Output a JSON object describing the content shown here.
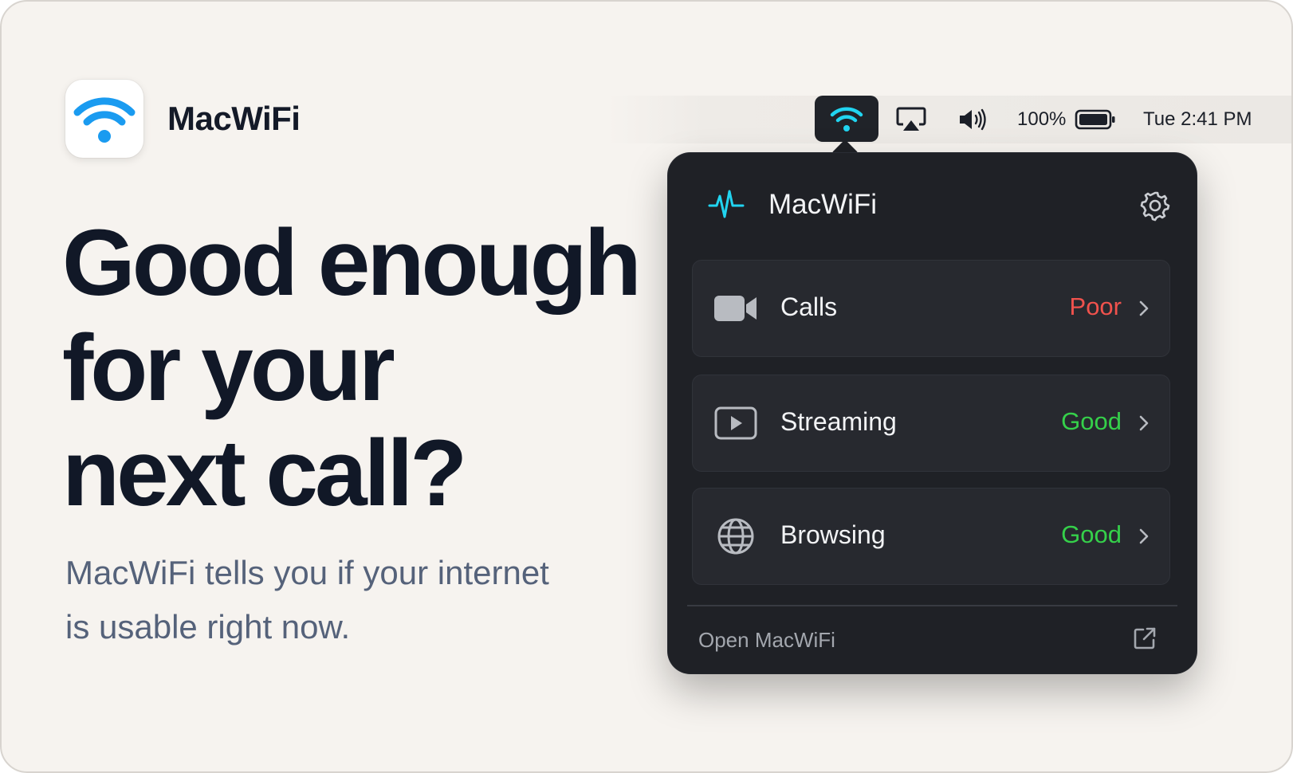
{
  "brand": {
    "app_name": "MacWiFi",
    "icon": "wifi-icon",
    "icon_color": "#1a9bf0"
  },
  "hero": {
    "headline_lines": [
      "Good enough",
      "for your",
      "next call?"
    ],
    "subtext_lines": [
      "MacWiFi tells you if your internet",
      "is usable right now."
    ]
  },
  "menubar": {
    "icons": [
      "wifi-icon",
      "airplay-icon",
      "volume-icon",
      "battery-icon"
    ],
    "wifi_icon_color": "#21d4f0",
    "battery_percent": "100%",
    "battery_level": 1.0,
    "clock": "Tue 2:41 PM"
  },
  "popover": {
    "title": "MacWiFi",
    "title_icon": "pulse-icon",
    "settings_icon": "gear-icon",
    "rows": [
      {
        "icon": "video-camera-icon",
        "label": "Calls",
        "status": "Poor",
        "status_color": "#f0524d"
      },
      {
        "icon": "play-icon",
        "label": "Streaming",
        "status": "Good",
        "status_color": "#35d04a"
      },
      {
        "icon": "globe-icon",
        "label": "Browsing",
        "status": "Good",
        "status_color": "#35d04a"
      }
    ],
    "footer_link": "Open MacWiFi",
    "footer_icon": "external-link-icon"
  },
  "colors": {
    "background": "#f6f3ef",
    "popover_bg": "#1f2126",
    "accent": "#21d4f0",
    "poor": "#f0524d",
    "good": "#35d04a"
  }
}
